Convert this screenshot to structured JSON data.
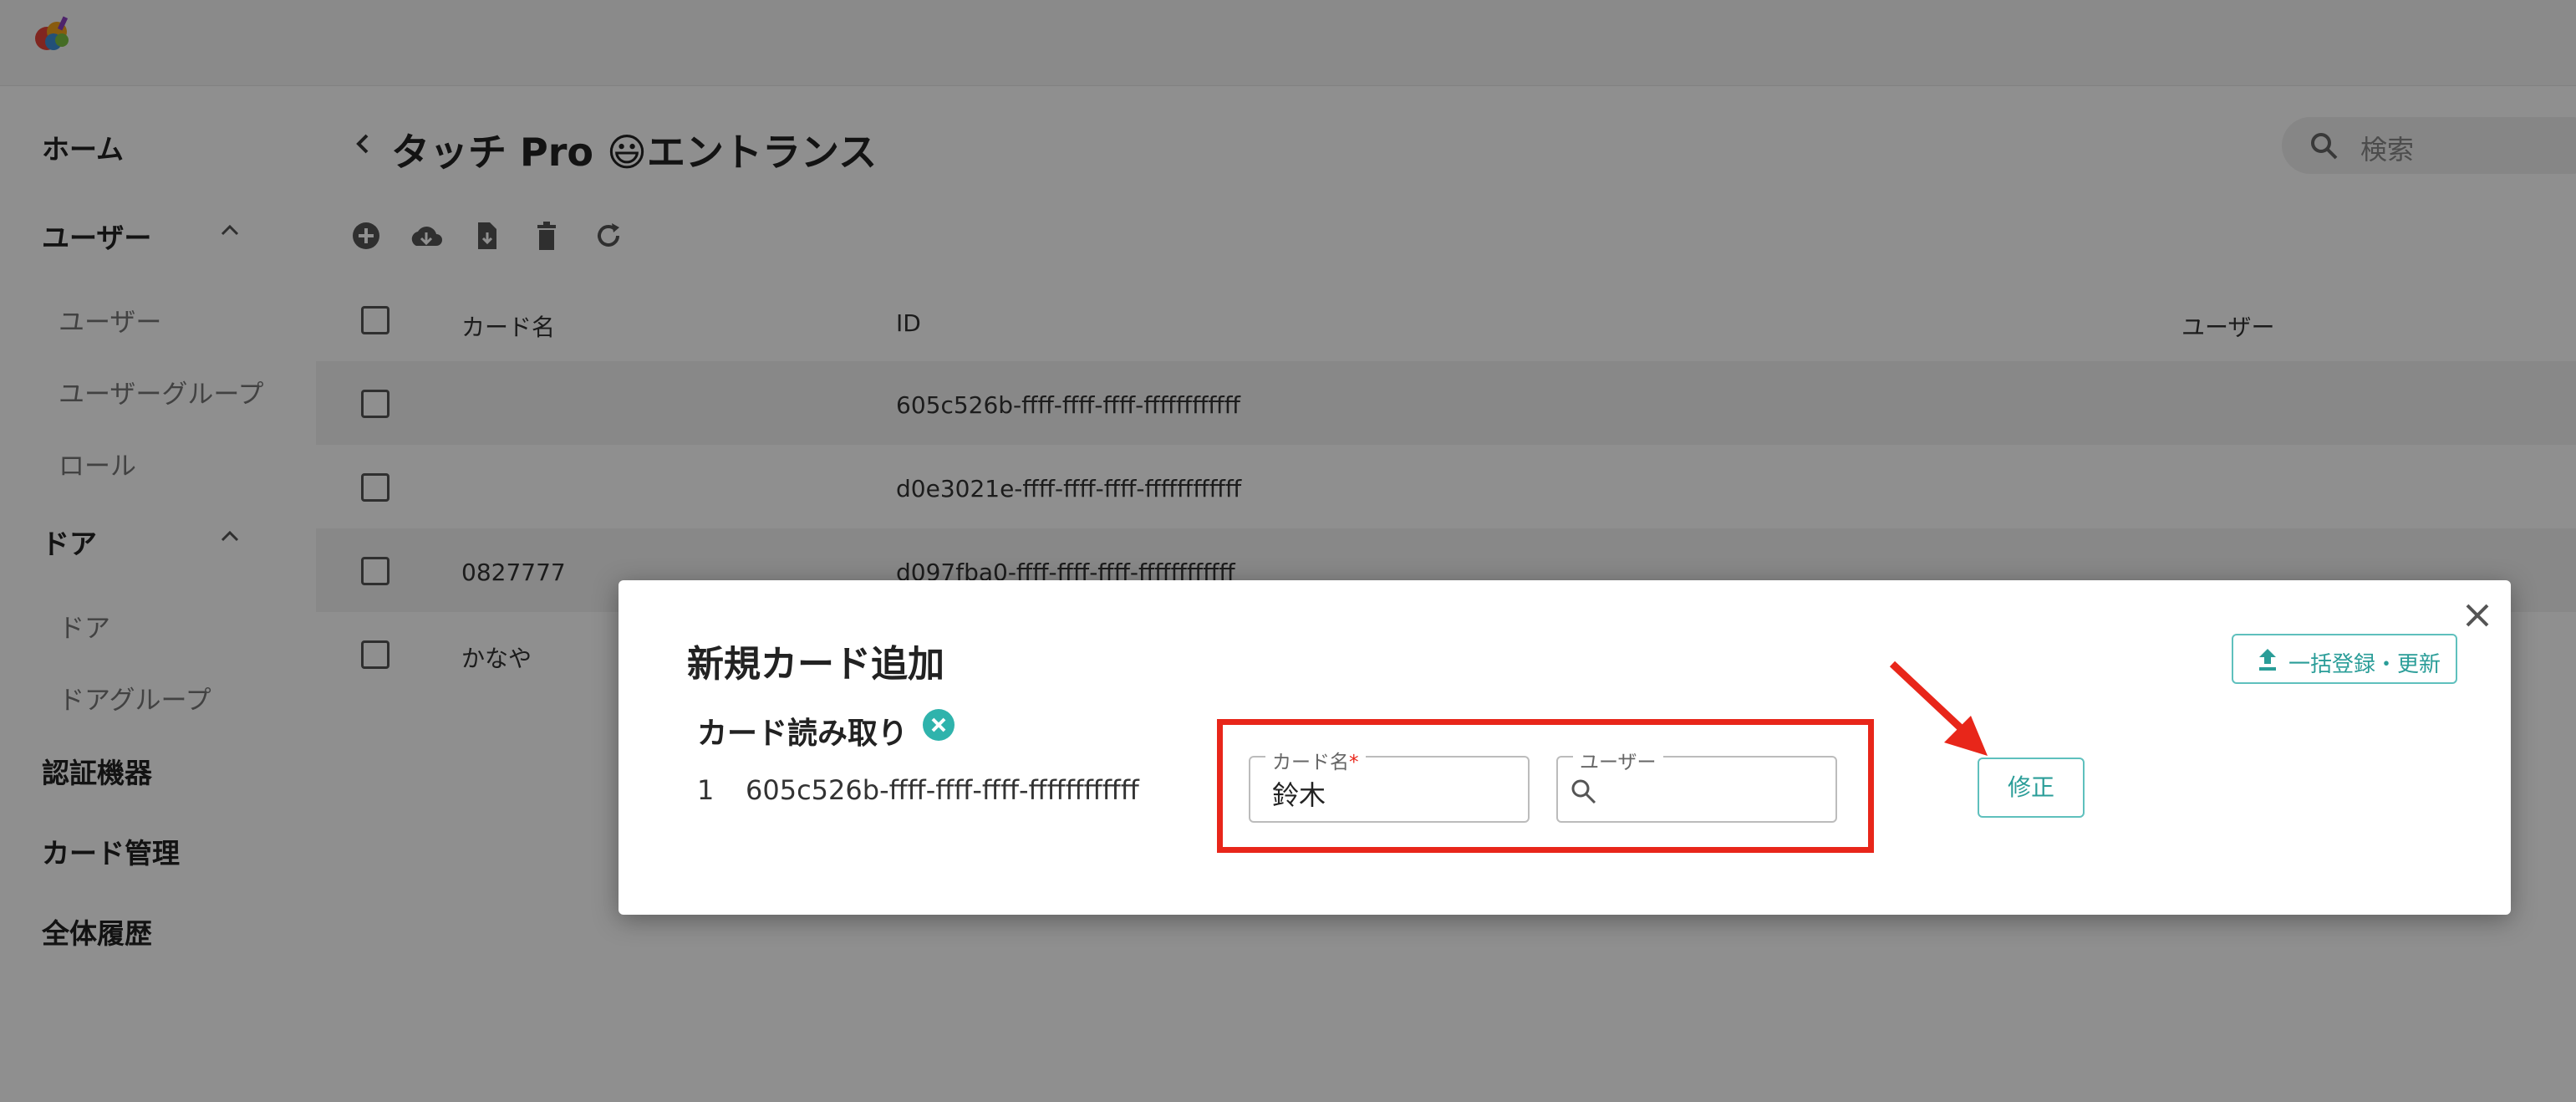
{
  "header": {
    "logo": "app-logo"
  },
  "sidebar": {
    "items": [
      {
        "label": "ホーム"
      },
      {
        "label": "ユーザー",
        "sub": [
          "ユーザー",
          "ユーザーグループ",
          "ロール"
        ]
      },
      {
        "label": "ドア",
        "sub": [
          "ドア",
          "ドアグループ"
        ]
      },
      {
        "label": "認証機器"
      },
      {
        "label": "カード管理"
      },
      {
        "label": "全体履歴"
      }
    ]
  },
  "main": {
    "title": "タッチ Pro 😃エントランス",
    "search": {
      "placeholder": "検索"
    },
    "toolbar": [
      "add-icon",
      "cloud-download-icon",
      "file-download-icon",
      "delete-icon",
      "refresh-icon"
    ],
    "table": {
      "columns": [
        "カード名",
        "ID",
        "ユーザー"
      ],
      "rows": [
        {
          "name": "",
          "id": "605c526b-ffff-ffff-ffff-ffffffffffff",
          "user": ""
        },
        {
          "name": "",
          "id": "d0e3021e-ffff-ffff-ffff-ffffffffffff",
          "user": ""
        },
        {
          "name": "0827777",
          "id": "d097fba0-ffff-ffff-ffff-ffffffffffff",
          "user": ""
        },
        {
          "name": "かなや",
          "id": "",
          "user": ""
        }
      ]
    }
  },
  "dialog": {
    "title": "新規カード追加",
    "bulk_button": "一括登録・更新",
    "reader_label": "カード読み取り",
    "reader_index": "1",
    "reader_id": "605c526b-ffff-ffff-ffff-ffffffffffff",
    "card_name_label": "カード名",
    "card_name_required": "*",
    "card_name_value": "鈴木",
    "user_label": "ユーザー",
    "user_value": "",
    "save_button": "修正"
  },
  "colors": {
    "accent": "#2a9d98",
    "highlight": "#e8261a"
  }
}
